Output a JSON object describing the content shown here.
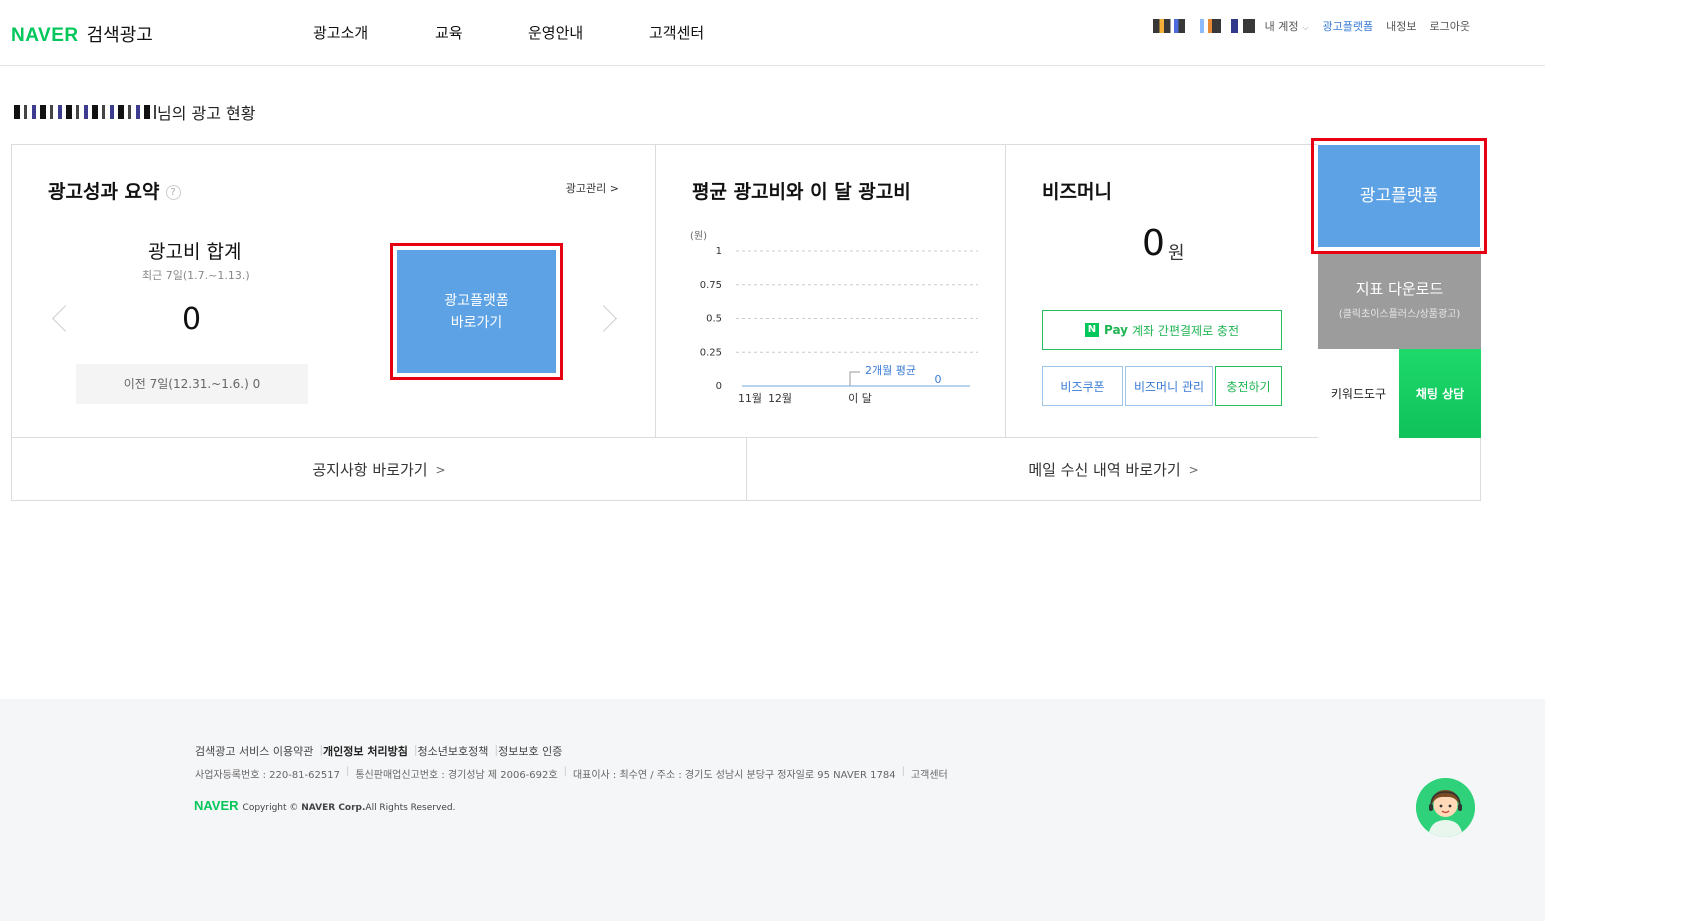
{
  "header": {
    "logo_brand": "NAVER",
    "logo_service": "검색광고",
    "nav": [
      "광고소개",
      "교육",
      "운영안내",
      "고객센터"
    ],
    "account_label": "내 계정",
    "platform_link": "광고플랫폼",
    "my_info": "내정보",
    "logout": "로그아웃"
  },
  "greeting": {
    "suffix": "님의 광고 현황"
  },
  "summary": {
    "title": "광고성과 요약",
    "help": "?",
    "manage_link": "광고관리 >",
    "total_label": "광고비 합계",
    "period": "최근 7일(1.7.~1.13.)",
    "total_value": "0",
    "previous": "이전 7일(12.31.~1.6.)  0",
    "platform_button_line1": "광고플랫폼",
    "platform_button_line2": "바로가기"
  },
  "chart_panel": {
    "title": "평균 광고비와 이 달 광고비"
  },
  "chart_data": {
    "type": "line",
    "ylabel": "(원)",
    "ylim": [
      0,
      1
    ],
    "y_ticks": [
      "1",
      "0.75",
      "0.5",
      "0.25",
      "0"
    ],
    "categories": [
      "11월",
      "12월",
      "이 달"
    ],
    "annotation": "2개월 평균",
    "current_value_label": "0",
    "grid": true,
    "series": [
      {
        "values": [
          0,
          0,
          0
        ]
      }
    ]
  },
  "bizmoney": {
    "title": "비즈머니",
    "value": "0",
    "unit": "원",
    "pay_badge": "N",
    "pay_word": "Pay",
    "pay_text": "계좌 간편결제로 충전",
    "coupon": "비즈쿠폰",
    "manage": "비즈머니 관리",
    "charge": "충전하기"
  },
  "side": {
    "platform": "광고플랫폼",
    "index_download": "지표 다운로드",
    "index_download_sub": "(클릭초이스플러스/상품광고)",
    "keyword_tool": "키워드도구",
    "chat": "채팅 상담"
  },
  "bottom_links": {
    "notice": "공지사항 바로가기",
    "mail": "메일 수신 내역 바로가기",
    "arrow": ">"
  },
  "footer": {
    "links": [
      "검색광고 서비스 이용약관",
      "개인정보 처리방침",
      "청소년보호정책",
      "정보보호 인증"
    ],
    "info": [
      "사업자등록번호 : 220-81-62517",
      "통신판매업신고번호 : 경기성남 제 2006-692호",
      "대표이사 : 최수연 / 주소 : 경기도 성남시 분당구 정자일로 95 NAVER 1784",
      "고객센터"
    ],
    "brand": "NAVER",
    "copyright_pre": "Copyright © ",
    "copyright_corp": "NAVER Corp.",
    "copyright_post": "All Rights Reserved."
  },
  "colors": {
    "accent_blue": "#5ca2e5",
    "naver_green": "#03c75a",
    "highlight_red": "#e60012"
  }
}
